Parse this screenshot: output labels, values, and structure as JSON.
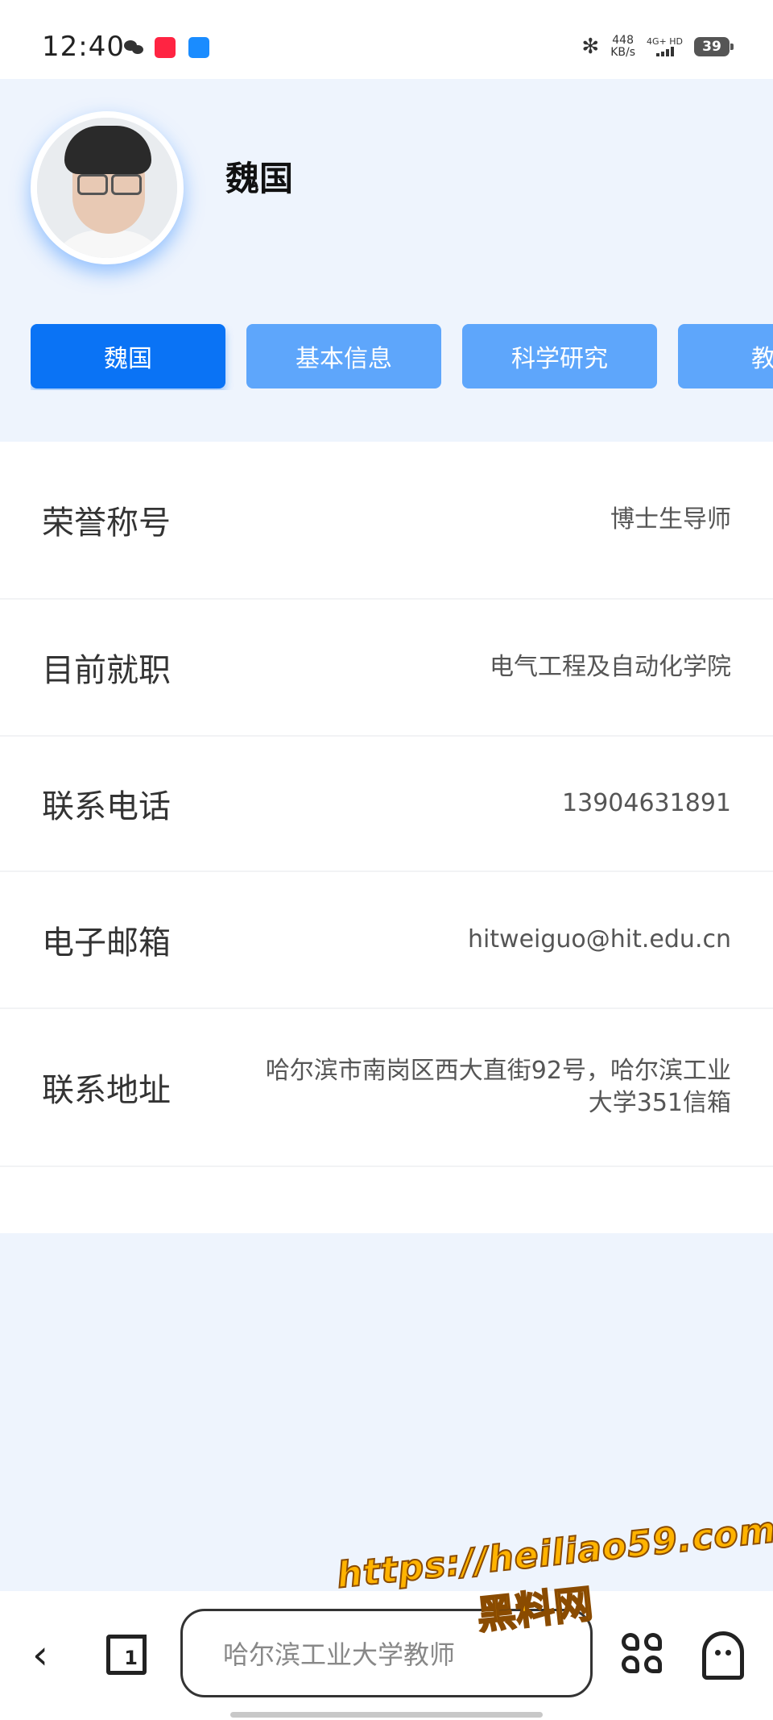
{
  "status_bar": {
    "time": "12:40",
    "net_speed_value": "448",
    "net_speed_unit": "KB/s",
    "network": "4G+ HD",
    "battery": "39"
  },
  "profile": {
    "name": "魏国"
  },
  "tabs": [
    {
      "label": "魏国",
      "active": true
    },
    {
      "label": "基本信息",
      "active": false
    },
    {
      "label": "科学研究",
      "active": false
    },
    {
      "label": "教育",
      "active": false
    }
  ],
  "info_rows": [
    {
      "label": "荣誉称号",
      "value": "博士生导师"
    },
    {
      "label": "目前就职",
      "value": "电气工程及自动化学院"
    },
    {
      "label": "联系电话",
      "value": "13904631891"
    },
    {
      "label": "电子邮箱",
      "value": "hitweiguo@hit.edu.cn"
    },
    {
      "label": "联系地址",
      "value": "哈尔滨市南岗区西大直街92号，哈尔滨工业大学351信箱"
    }
  ],
  "bottom_nav": {
    "search_text": "哈尔滨工业大学教师"
  },
  "watermark": {
    "url": "https://heiliao59.com",
    "site": "黑料网"
  },
  "colors": {
    "accent": "#0a73f5",
    "tab_inactive": "#5ea6fb",
    "page_bg": "#eef4fd"
  }
}
